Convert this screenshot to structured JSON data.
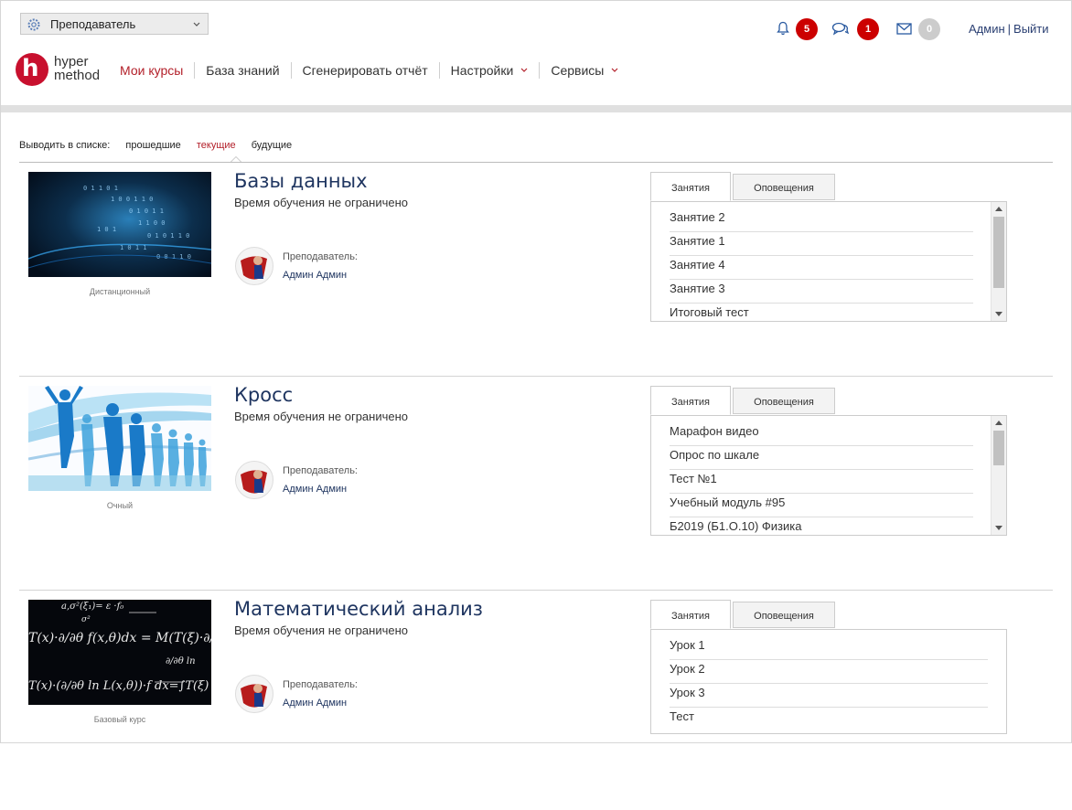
{
  "role_selector": {
    "value": "Преподаватель",
    "icon": "gear-icon"
  },
  "logo": {
    "line1": "hyper",
    "line2": "method",
    "mark": "h"
  },
  "nav": {
    "items": [
      {
        "label": "Мои курсы"
      },
      {
        "label": "База знаний"
      },
      {
        "label": "Сгенерировать отчёт"
      },
      {
        "label": "Настройки"
      },
      {
        "label": "Сервисы"
      }
    ]
  },
  "notifications": {
    "bell": "5",
    "chat": "1",
    "mail": "0"
  },
  "user": {
    "name": "Админ",
    "logout": "Выйти",
    "sep": "|"
  },
  "filter": {
    "label": "Выводить в списке:",
    "past": "прошедшие",
    "current": "текущие",
    "future": "будущие"
  },
  "tabs": {
    "lessons": "Занятия",
    "notices": "Оповещения"
  },
  "courses": [
    {
      "title": "Базы данных",
      "duration": "Время обучения не ограничено",
      "type": "Дистанционный",
      "teacher_label": "Преподаватель:",
      "teacher": "Админ Админ",
      "lessons": [
        "Занятие 2",
        "Занятие 1",
        "Занятие 4",
        "Занятие 3",
        "Итоговый тест"
      ]
    },
    {
      "title": "Кросс",
      "duration": "Время обучения не ограничено",
      "type": "Очный",
      "teacher_label": "Преподаватель:",
      "teacher": "Админ Админ",
      "lessons": [
        "Марафон видео",
        "Опрос по шкале",
        "Тест №1",
        "Учебный модуль #95",
        "Б2019 (Б1.О.10) Физика"
      ]
    },
    {
      "title": "Математический анализ",
      "duration": "Время обучения не ограничено",
      "type": "Базовый курс",
      "teacher_label": "Преподаватель:",
      "teacher": "Админ Админ",
      "lessons": [
        "Урок 1",
        "Урок 2",
        "Урок 3",
        "Тест"
      ]
    }
  ],
  "colors": {
    "accent": "#b3202a",
    "link": "#1f3560",
    "badge": "#cc0000"
  }
}
